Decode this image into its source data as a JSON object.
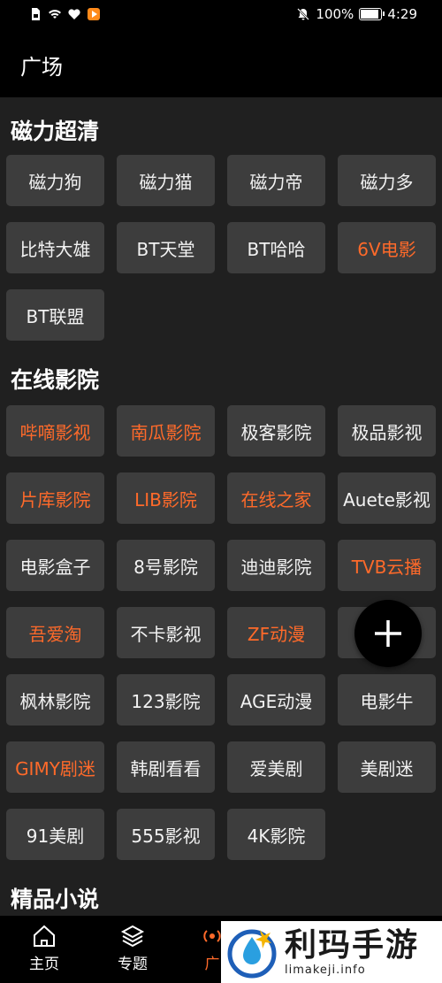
{
  "status_bar": {
    "battery": "100%",
    "battery_level": 100,
    "time": "4:29",
    "icons": [
      "sim-icon",
      "wifi-icon",
      "heart-icon",
      "play-app-icon",
      "mute-icon",
      "battery-icon"
    ]
  },
  "header": {
    "title": "广场"
  },
  "sections": [
    {
      "title": "磁力超清",
      "items": [
        {
          "label": "磁力狗",
          "highlight": false
        },
        {
          "label": "磁力猫",
          "highlight": false
        },
        {
          "label": "磁力帝",
          "highlight": false
        },
        {
          "label": "磁力多",
          "highlight": false
        },
        {
          "label": "比特大雄",
          "highlight": false
        },
        {
          "label": "BT天堂",
          "highlight": false
        },
        {
          "label": "BT哈哈",
          "highlight": false
        },
        {
          "label": "6V电影",
          "highlight": true
        },
        {
          "label": "BT联盟",
          "highlight": false
        }
      ]
    },
    {
      "title": "在线影院",
      "items": [
        {
          "label": "哔嘀影视",
          "highlight": true
        },
        {
          "label": "南瓜影院",
          "highlight": true
        },
        {
          "label": "极客影院",
          "highlight": false
        },
        {
          "label": "极品影视",
          "highlight": false
        },
        {
          "label": "片库影院",
          "highlight": true
        },
        {
          "label": "LIB影院",
          "highlight": true
        },
        {
          "label": "在线之家",
          "highlight": true
        },
        {
          "label": "Auete影视",
          "highlight": false
        },
        {
          "label": "电影盒子",
          "highlight": false
        },
        {
          "label": "8号影院",
          "highlight": false
        },
        {
          "label": "迪迪影院",
          "highlight": false
        },
        {
          "label": "TVB云播",
          "highlight": true
        },
        {
          "label": "吾爱淘",
          "highlight": true
        },
        {
          "label": "不卡影视",
          "highlight": false
        },
        {
          "label": "ZF动漫",
          "highlight": true
        },
        {
          "label": "",
          "highlight": false
        },
        {
          "label": "枫林影院",
          "highlight": false
        },
        {
          "label": "123影院",
          "highlight": false
        },
        {
          "label": "AGE动漫",
          "highlight": false
        },
        {
          "label": "电影牛",
          "highlight": false
        },
        {
          "label": "GIMY剧迷",
          "highlight": true
        },
        {
          "label": "韩剧看看",
          "highlight": false
        },
        {
          "label": "爱美剧",
          "highlight": false
        },
        {
          "label": "美剧迷",
          "highlight": false
        },
        {
          "label": "91美剧",
          "highlight": false
        },
        {
          "label": "555影视",
          "highlight": false
        },
        {
          "label": "4K影院",
          "highlight": false
        }
      ]
    },
    {
      "title": "精品小说",
      "items": []
    }
  ],
  "fab": {
    "icon": "plus-icon"
  },
  "bottom_nav": [
    {
      "label": "主页",
      "icon": "home-icon",
      "active": false
    },
    {
      "label": "专题",
      "icon": "layers-icon",
      "active": false
    },
    {
      "label": "广",
      "icon": "broadcast-icon",
      "active": true
    }
  ],
  "watermark": {
    "title": "利玛手游",
    "url": "limakeji.info"
  },
  "colors": {
    "highlight": "#ff6a2a",
    "chip_bg": "#3d3d3d",
    "background": "#202020"
  }
}
